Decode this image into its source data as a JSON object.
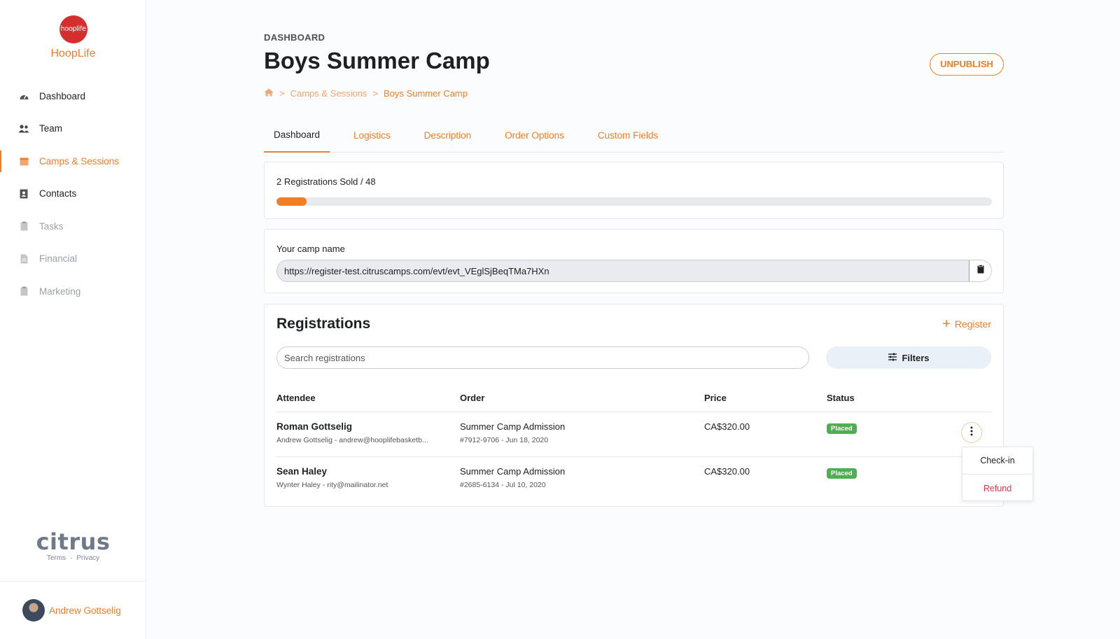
{
  "app": {
    "logo_text": "hooplife",
    "name": "HoopLife"
  },
  "sidebar": {
    "items": [
      {
        "label": "Dashboard",
        "icon": "gauge-icon",
        "state": "normal"
      },
      {
        "label": "Team",
        "icon": "users-icon",
        "state": "normal"
      },
      {
        "label": "Camps & Sessions",
        "icon": "calendar-icon",
        "state": "active"
      },
      {
        "label": "Contacts",
        "icon": "address-book-icon",
        "state": "normal"
      },
      {
        "label": "Tasks",
        "icon": "clipboard-icon",
        "state": "muted"
      },
      {
        "label": "Financial",
        "icon": "document-icon",
        "state": "muted"
      },
      {
        "label": "Marketing",
        "icon": "clipboard-icon",
        "state": "muted"
      }
    ],
    "footer_logo": "citrus",
    "terms": "Terms",
    "dot": "·",
    "privacy": "Privacy",
    "user_name": "Andrew Gottselig"
  },
  "header": {
    "eyebrow": "DASHBOARD",
    "title": "Boys Summer Camp",
    "unpublish": "UNPUBLISH",
    "breadcrumb": {
      "sep": ">",
      "section": "Camps & Sessions",
      "current": "Boys Summer Camp"
    }
  },
  "tabs": [
    "Dashboard",
    "Logistics",
    "Description",
    "Order Options",
    "Custom Fields"
  ],
  "sold": {
    "text": "2 Registrations Sold / 48",
    "progress_fraction": 0.042
  },
  "camp_link": {
    "label": "Your camp name",
    "url": "https://register-test.citruscamps.com/evt/evt_VEglSjBeqTMa7HXn"
  },
  "registrations": {
    "title": "Registrations",
    "register_label": "Register",
    "search_placeholder": "Search registrations",
    "filters_label": "Filters",
    "columns": [
      "Attendee",
      "Order",
      "Price",
      "Status"
    ],
    "rows": [
      {
        "name": "Roman Gottselig",
        "contact": "Andrew Gottselig - andrew@hooplifebasketb...",
        "order": "Summer Camp Admission",
        "order_meta": "#7912-9706 - Jun 18, 2020",
        "price": "CA$320.00",
        "status": "Placed"
      },
      {
        "name": "Sean Haley",
        "contact": "Wynter Haley - rity@mailinator.net",
        "order": "Summer Camp Admission",
        "order_meta": "#2685-6134 - Jul 10, 2020",
        "price": "CA$320.00",
        "status": "Placed"
      }
    ]
  },
  "row_menu": {
    "checkin": "Check-in",
    "refund": "Refund"
  },
  "colors": {
    "accent": "#f07e26",
    "brand_red": "#d32f2f",
    "status_green": "#4caf50",
    "refund_red": "#e0344a"
  }
}
